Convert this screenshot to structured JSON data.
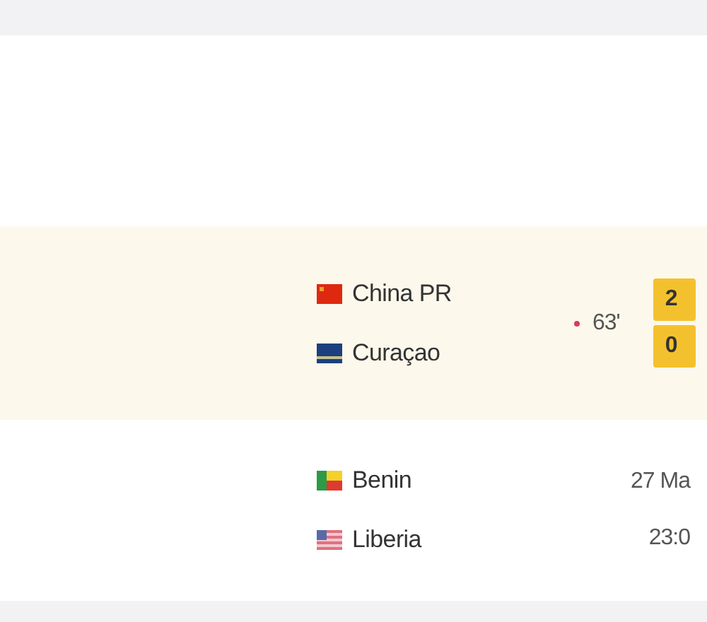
{
  "matches": [
    {
      "kind": "live",
      "teams": [
        {
          "name": "China PR",
          "kind": "china"
        },
        {
          "name": "Curaçao",
          "kind": "curacao"
        }
      ],
      "minute": "63'",
      "scores": [
        "2",
        "0"
      ]
    },
    {
      "kind": "scheduled",
      "teams": [
        {
          "name": "Benin",
          "kind": "benin"
        },
        {
          "name": "Liberia",
          "kind": "liberia"
        }
      ],
      "date": "27 Ma",
      "time": "23:0"
    }
  ]
}
